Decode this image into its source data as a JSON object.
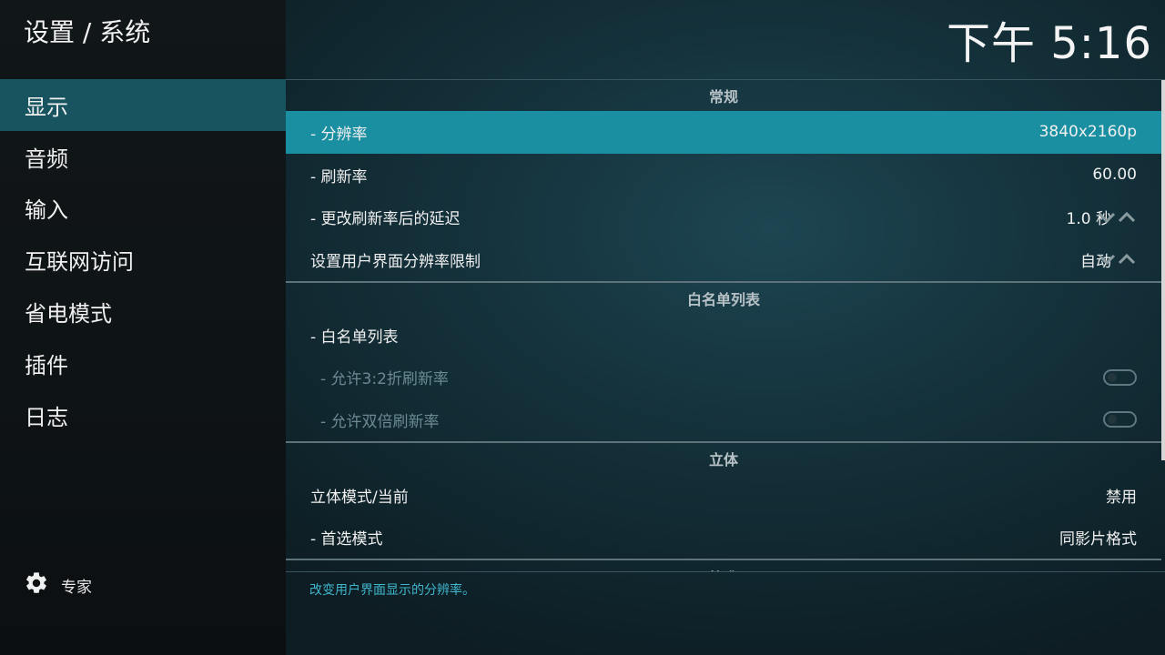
{
  "header": {
    "breadcrumb": "设置 / 系统",
    "clock": "下午 5:16"
  },
  "sidebar": {
    "items": [
      {
        "label": "显示"
      },
      {
        "label": "音频"
      },
      {
        "label": "输入"
      },
      {
        "label": "互联网访问"
      },
      {
        "label": "省电模式"
      },
      {
        "label": "插件"
      },
      {
        "label": "日志"
      }
    ],
    "active_index": 0,
    "expert_label": "专家"
  },
  "sections": {
    "general": {
      "title": "常规",
      "resolution": {
        "label": "- 分辨率",
        "value": "3840x2160p"
      },
      "refresh_rate": {
        "label": "- 刷新率",
        "value": "60.00"
      },
      "delay": {
        "label": "- 更改刷新率后的延迟",
        "value": "1.0 秒"
      },
      "ui_limit": {
        "label": "设置用户界面分辨率限制",
        "value": "自动"
      }
    },
    "whitelist": {
      "title": "白名单列表",
      "list": {
        "label": "- 白名单列表"
      },
      "allow_32": {
        "label": "- 允许3:2折刷新率"
      },
      "allow_double": {
        "label": "- 允许双倍刷新率"
      }
    },
    "stereo": {
      "title": "立体",
      "mode": {
        "label": "立体模式/当前",
        "value": "禁用"
      },
      "preferred": {
        "label": "- 首选模式",
        "value": "同影片格式"
      }
    },
    "next": {
      "title": "校准"
    }
  },
  "footer": {
    "description": "改变用户界面显示的分辨率。"
  },
  "colors": {
    "accent": "#1a8fa2",
    "sidebar_active": "#17545f",
    "description_text": "#3fb6cc"
  }
}
